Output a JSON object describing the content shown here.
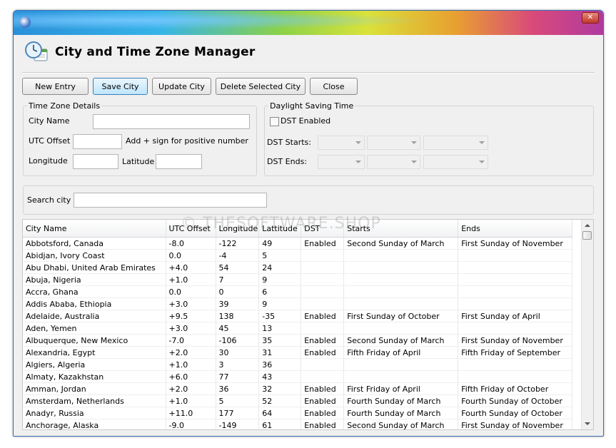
{
  "window": {
    "title": "City and Time Zone Manager"
  },
  "toolbar": {
    "new_entry": "New Entry",
    "save_city": "Save City",
    "update_city": "Update City",
    "delete_city": "Delete Selected City",
    "close": "Close"
  },
  "tz_details": {
    "title": "Time Zone Details",
    "city_name_label": "City Name",
    "utc_offset_label": "UTC Offset",
    "utc_hint": "Add + sign for positive  number",
    "longitude_label": "Longitude",
    "latitude_label": "Latitude"
  },
  "dst": {
    "title": "Daylight Saving Time",
    "enabled_label": "DST Enabled",
    "starts_label": "DST Starts:",
    "ends_label": "DST Ends:"
  },
  "search": {
    "label": "Search city"
  },
  "watermark": "© THESOFTWARE.SHOP",
  "table": {
    "columns": [
      "City Name",
      "UTC Offset",
      "Longitude",
      "Lattitude",
      "DST",
      "Starts",
      "Ends"
    ],
    "rows": [
      [
        "Abbotsford, Canada",
        "-8.0",
        "-122",
        "49",
        "Enabled",
        "Second Sunday of March",
        "First Sunday of November"
      ],
      [
        "Abidjan, Ivory Coast",
        "0.0",
        "-4",
        "5",
        "",
        "",
        ""
      ],
      [
        "Abu Dhabi, United Arab Emirates",
        "+4.0",
        "54",
        "24",
        "",
        "",
        ""
      ],
      [
        "Abuja, Nigeria",
        "+1.0",
        "7",
        "9",
        "",
        "",
        ""
      ],
      [
        "Accra, Ghana",
        "0.0",
        "0",
        "6",
        "",
        "",
        ""
      ],
      [
        "Addis Ababa, Ethiopia",
        "+3.0",
        "39",
        "9",
        "",
        "",
        ""
      ],
      [
        "Adelaide, Australia",
        "+9.5",
        "138",
        "-35",
        "Enabled",
        "First Sunday of October",
        "First Sunday of April"
      ],
      [
        "Aden, Yemen",
        "+3.0",
        "45",
        "13",
        "",
        "",
        ""
      ],
      [
        "Albuquerque, New Mexico",
        "-7.0",
        "-106",
        "35",
        "Enabled",
        "Second Sunday of March",
        "First Sunday of November"
      ],
      [
        "Alexandria, Egypt",
        "+2.0",
        "30",
        "31",
        "Enabled",
        "Fifth Friday of April",
        "Fifth Friday of September"
      ],
      [
        "Algiers, Algeria",
        "+1.0",
        "3",
        "36",
        "",
        "",
        ""
      ],
      [
        "Almaty, Kazakhstan",
        "+6.0",
        "77",
        "43",
        "",
        "",
        ""
      ],
      [
        "Amman, Jordan",
        "+2.0",
        "36",
        "32",
        "Enabled",
        "First Friday of April",
        "Fifth Friday of October"
      ],
      [
        "Amsterdam, Netherlands",
        "+1.0",
        "5",
        "52",
        "Enabled",
        "Fourth Sunday of March",
        "Fourth Sunday of October"
      ],
      [
        "Anadyr, Russia",
        "+11.0",
        "177",
        "64",
        "Enabled",
        "Fourth Sunday of March",
        "Fourth Sunday of October"
      ],
      [
        "Anchorage, Alaska",
        "-9.0",
        "-149",
        "61",
        "Enabled",
        "Second Sunday of March",
        "First Sunday of November"
      ]
    ]
  }
}
